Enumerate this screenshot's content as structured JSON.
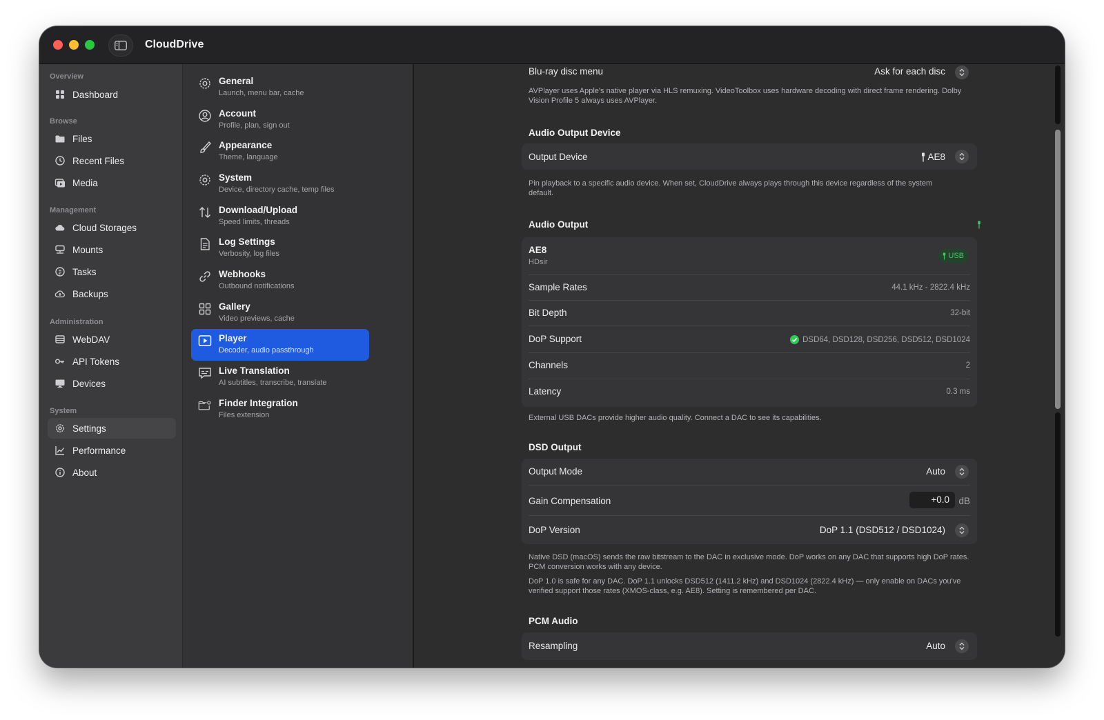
{
  "app": {
    "title": "CloudDrive"
  },
  "sidebar": {
    "sections": [
      {
        "label": "Overview",
        "items": [
          {
            "label": "Dashboard",
            "icon": "dashboard-icon"
          }
        ]
      },
      {
        "label": "Browse",
        "items": [
          {
            "label": "Files",
            "icon": "folder-icon"
          },
          {
            "label": "Recent Files",
            "icon": "clock-icon"
          },
          {
            "label": "Media",
            "icon": "media-icon"
          }
        ]
      },
      {
        "label": "Management",
        "items": [
          {
            "label": "Cloud Storages",
            "icon": "cloud-icon"
          },
          {
            "label": "Mounts",
            "icon": "drive-icon"
          },
          {
            "label": "Tasks",
            "icon": "tasks-icon"
          },
          {
            "label": "Backups",
            "icon": "backup-icon"
          }
        ]
      },
      {
        "label": "Administration",
        "items": [
          {
            "label": "WebDAV",
            "icon": "server-icon"
          },
          {
            "label": "API Tokens",
            "icon": "key-icon"
          },
          {
            "label": "Devices",
            "icon": "monitor-icon"
          }
        ]
      },
      {
        "label": "System",
        "items": [
          {
            "label": "Settings",
            "icon": "gear-icon"
          },
          {
            "label": "Performance",
            "icon": "chart-icon"
          },
          {
            "label": "About",
            "icon": "info-icon"
          }
        ]
      }
    ]
  },
  "settings_list": [
    {
      "title": "General",
      "subtitle": "Launch, menu bar, cache",
      "icon": "gear-icon"
    },
    {
      "title": "Account",
      "subtitle": "Profile, plan, sign out",
      "icon": "person-icon"
    },
    {
      "title": "Appearance",
      "subtitle": "Theme, language",
      "icon": "paintbrush-icon"
    },
    {
      "title": "System",
      "subtitle": "Device, directory cache, temp files",
      "icon": "gear-icon"
    },
    {
      "title": "Download/Upload",
      "subtitle": "Speed limits, threads",
      "icon": "arrows-updown-icon"
    },
    {
      "title": "Log Settings",
      "subtitle": "Verbosity, log files",
      "icon": "document-icon"
    },
    {
      "title": "Webhooks",
      "subtitle": "Outbound notifications",
      "icon": "link-icon"
    },
    {
      "title": "Gallery",
      "subtitle": "Video previews, cache",
      "icon": "grid-icon"
    },
    {
      "title": "Player",
      "subtitle": "Decoder, audio passthrough",
      "icon": "play-icon"
    },
    {
      "title": "Live Translation",
      "subtitle": "AI subtitles, transcribe, translate",
      "icon": "caption-icon"
    },
    {
      "title": "Finder Integration",
      "subtitle": "Files extension",
      "icon": "finder-folder-icon"
    }
  ],
  "main": {
    "bluray": {
      "label": "Blu-ray disc menu",
      "value": "Ask for each disc"
    },
    "bluray_note": "AVPlayer uses Apple's native player via HLS remuxing. VideoToolbox uses hardware decoding with direct frame rendering. Dolby Vision Profile 5 always uses AVPlayer.",
    "audio_output_device": {
      "title": "Audio Output Device",
      "label": "Output Device",
      "value": "AE8",
      "note": "Pin playback to a specific audio device. When set, CloudDrive always plays through this device regardless of the system default."
    },
    "audio_output": {
      "title": "Audio Output",
      "device_name": "AE8",
      "device_vendor": "HDsir",
      "badge": "USB",
      "rows": [
        {
          "label": "Sample Rates",
          "value": "44.1 kHz - 2822.4 kHz"
        },
        {
          "label": "Bit Depth",
          "value": "32-bit"
        },
        {
          "label": "DoP Support",
          "value": "DSD64, DSD128, DSD256, DSD512, DSD1024"
        },
        {
          "label": "Channels",
          "value": "2"
        },
        {
          "label": "Latency",
          "value": "0.3 ms"
        }
      ],
      "note": "External USB DACs provide higher audio quality. Connect a DAC to see its capabilities."
    },
    "dsd_output": {
      "title": "DSD Output",
      "output_mode": {
        "label": "Output Mode",
        "value": "Auto"
      },
      "gain": {
        "label": "Gain Compensation",
        "value": "+0.0",
        "unit": "dB"
      },
      "dop_version": {
        "label": "DoP Version",
        "value": "DoP 1.1 (DSD512 / DSD1024)"
      },
      "note1": "Native DSD (macOS) sends the raw bitstream to the DAC in exclusive mode. DoP works on any DAC that supports high DoP rates. PCM conversion works with any device.",
      "note2": "DoP 1.0 is safe for any DAC. DoP 1.1 unlocks DSD512 (1411.2 kHz) and DSD1024 (2822.4 kHz) — only enable on DACs you've verified support those rates (XMOS-class, e.g. AE8). Setting is remembered per DAC."
    },
    "pcm_audio": {
      "title": "PCM Audio",
      "resampling": {
        "label": "Resampling",
        "value": "Auto"
      }
    }
  },
  "colors": {
    "accent": "#1f5be0",
    "success": "#34c759",
    "usb_badge": "#46c46a"
  }
}
